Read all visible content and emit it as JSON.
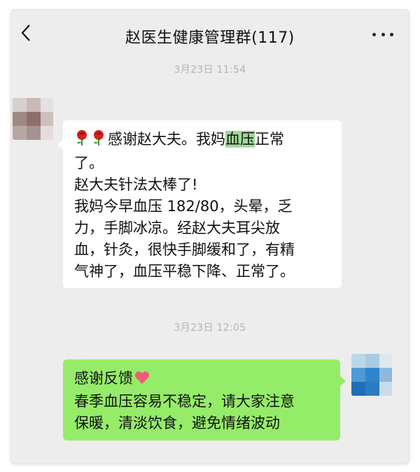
{
  "header": {
    "title": "赵医生健康管理群(117)"
  },
  "messages": [
    {
      "time": "3月23日 11:54",
      "side": "left",
      "lines": {
        "l1_pre": "感谢赵大夫。我妈",
        "l1_hl": "血压",
        "l1_post": "正常",
        "l2": "了。",
        "l3": "赵大夫针法太棒了!",
        "l4": "我妈今早血压 182/80，头晕，乏",
        "l5": "力，手脚冰凉。经赵大夫耳尖放",
        "l6": "血，针灸，很快手脚缓和了，有精",
        "l7": "气神了，血压平稳下降、正常了。"
      },
      "emoji": [
        "rose-icon",
        "rose-icon"
      ]
    },
    {
      "time": "3月23日 12:05",
      "side": "right",
      "lines": {
        "l1": "感谢反馈",
        "l2": "春季血压容易不稳定，请大家注意",
        "l3": "保暖，清淡饮食，避免情绪波动"
      },
      "emoji": [
        "heart-icon"
      ]
    }
  ],
  "colors": {
    "background": "#ededed",
    "left_bubble": "#ffffff",
    "right_bubble": "#95ec69",
    "highlight": "#9fd89a",
    "timestamp": "#b3b3b3"
  }
}
